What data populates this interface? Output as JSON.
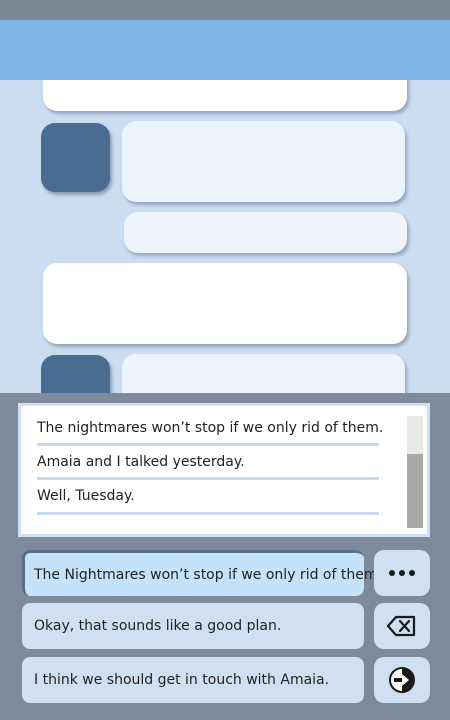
{
  "transcript": {
    "lines": [
      "The nightmares won’t stop if we only rid of them.",
      "Amaia and I talked yesterday.",
      "Well, Tuesday."
    ]
  },
  "replies": [
    {
      "label": "The Nightmares won’t stop if we only rid of them.",
      "selected": true
    },
    {
      "label": "Okay, that sounds like a good plan.",
      "selected": false
    },
    {
      "label": "I think we should get in touch with Amaia.",
      "selected": false
    }
  ],
  "actions": {
    "more_icon": "ellipsis-icon",
    "backspace_icon": "backspace-icon",
    "send_icon": "send-arrow-icon"
  },
  "colors": {
    "header": "#7fb6e6",
    "chat_background": "#cbddf0",
    "avatar": "#4b6c91",
    "panel": "#7d8a9b",
    "reply_button": "#cfe0f2"
  }
}
